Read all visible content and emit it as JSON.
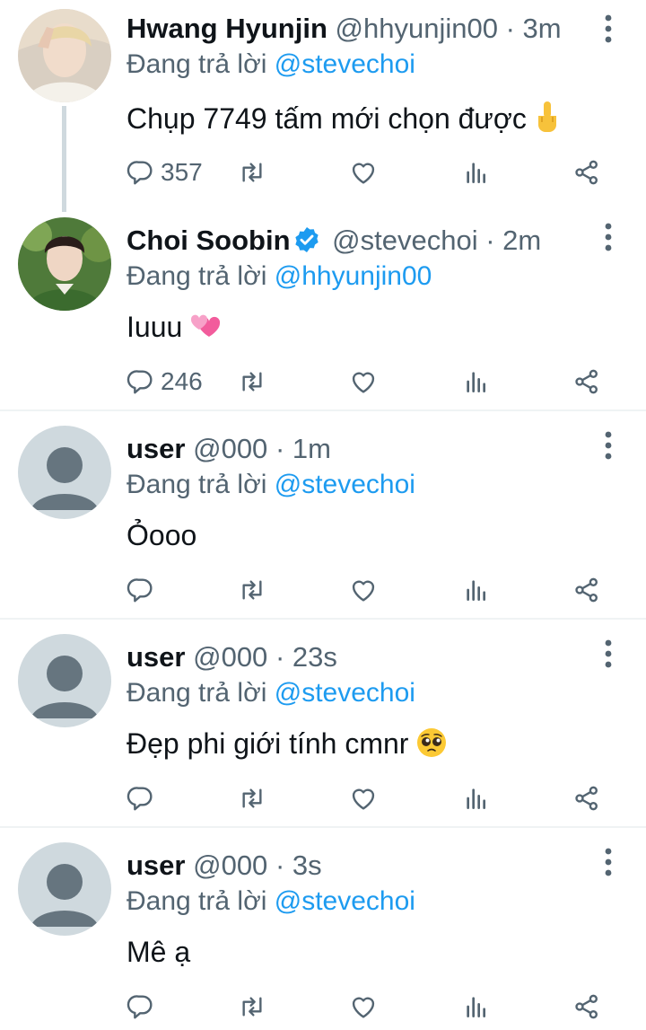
{
  "replying_prefix": "Đang trả lời",
  "colors": {
    "link": "#1d9bf0",
    "secondary": "#536471",
    "divider": "#eff3f4",
    "thread_line": "#cfd9de"
  },
  "tweets": [
    {
      "name": "Hwang Hyunjin",
      "handle": "@hhyunjin00",
      "dot": "·",
      "time": "3m",
      "replying_to": "@stevechoi",
      "text": "Chụp 7749 tấm mới chọn được",
      "emoji": "middle-finger",
      "reply_count": "357",
      "verified": false,
      "avatar": "photo-blond"
    },
    {
      "name": "Choi Soobin",
      "handle": "@stevechoi",
      "dot": "·",
      "time": "2m",
      "replying_to": "@hhyunjin00",
      "text": "Iuuu",
      "emoji": "two-hearts",
      "reply_count": "246",
      "verified": true,
      "avatar": "photo-green"
    },
    {
      "name": "user",
      "handle": "@000",
      "dot": "·",
      "time": "1m",
      "replying_to": "@stevechoi",
      "text": "Ỏooo",
      "emoji": "",
      "reply_count": "",
      "verified": false,
      "avatar": "default"
    },
    {
      "name": "user",
      "handle": "@000",
      "dot": "·",
      "time": "23s",
      "replying_to": "@stevechoi",
      "text": "Đẹp phi giới tính cmnr",
      "emoji": "pleading-face",
      "reply_count": "",
      "verified": false,
      "avatar": "default"
    },
    {
      "name": "user",
      "handle": "@000",
      "dot": "·",
      "time": "3s",
      "replying_to": "@stevechoi",
      "text": "Mê ạ",
      "emoji": "",
      "reply_count": "",
      "verified": false,
      "avatar": "default"
    }
  ]
}
